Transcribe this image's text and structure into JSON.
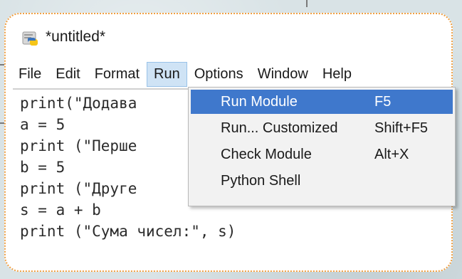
{
  "window": {
    "title": "*untitled*"
  },
  "menubar": {
    "items": [
      "File",
      "Edit",
      "Format",
      "Run",
      "Options",
      "Window",
      "Help"
    ],
    "active": "Run"
  },
  "editor": {
    "lines": [
      "print(\"Додава",
      "a = 5",
      "print (\"Перше",
      "b = 5",
      "print (\"Друге",
      "s = a + b",
      "print (\"Сума чисел:\", s)"
    ]
  },
  "run_menu": {
    "items": [
      {
        "label": "Run Module",
        "shortcut": "F5",
        "highlighted": true
      },
      {
        "label": "Run... Customized",
        "shortcut": "Shift+F5",
        "highlighted": false
      },
      {
        "label": "Check Module",
        "shortcut": "Alt+X",
        "highlighted": false
      },
      {
        "label": "Python Shell",
        "shortcut": "",
        "highlighted": false
      }
    ]
  },
  "colors": {
    "card_border": "#f0a043",
    "menu_highlight": "#3f78cc",
    "active_menu_bg": "#cfe3f5"
  },
  "icons": {
    "app": "python-idle-icon"
  }
}
